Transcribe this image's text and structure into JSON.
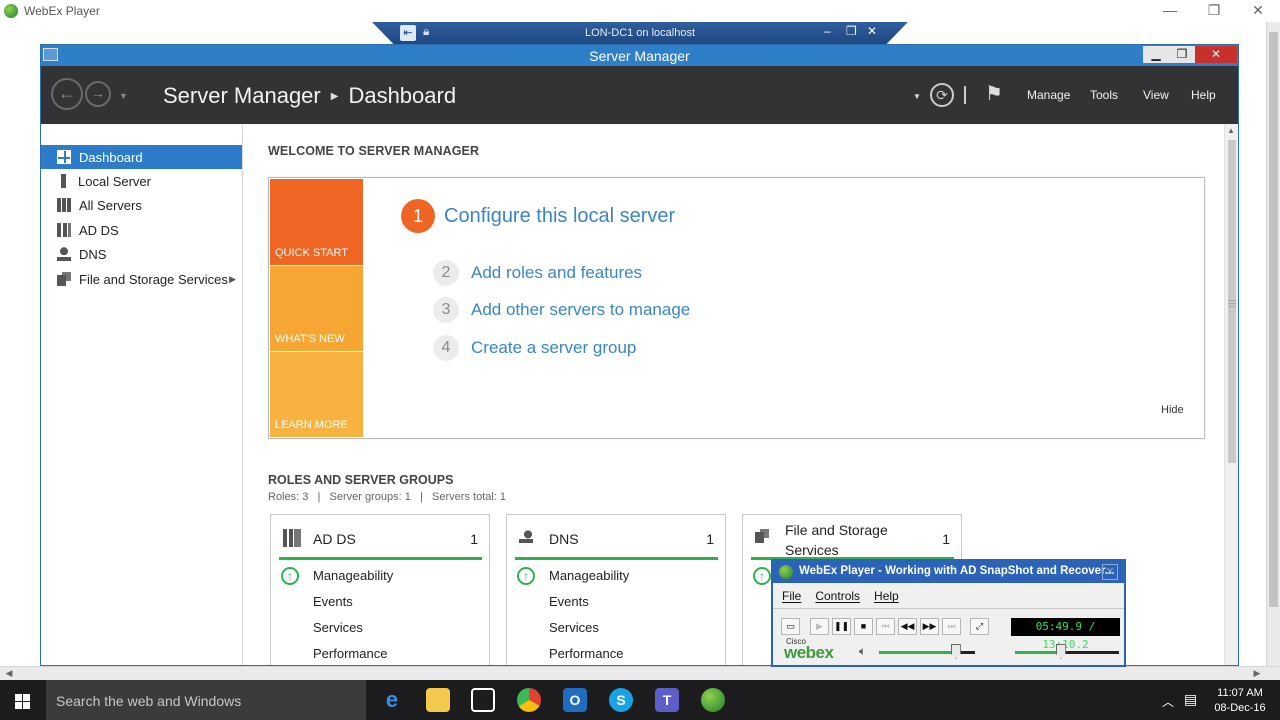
{
  "webex": {
    "title": "WebEx Player",
    "controls": {
      "minimize": "—",
      "restore": "❐",
      "close": "✕"
    }
  },
  "rdp": {
    "title": "LON-DC1 on localhost",
    "controls": {
      "minimize": "–",
      "restore": "❐",
      "close": "✕"
    }
  },
  "server_manager": {
    "window_title": "Server Manager",
    "breadcrumb": {
      "root": "Server Manager",
      "current": "Dashboard"
    },
    "header_menu": [
      "Manage",
      "Tools",
      "View",
      "Help"
    ],
    "nav_items": [
      {
        "label": "Dashboard",
        "icon": "dashboard-icon",
        "active": true
      },
      {
        "label": "Local Server",
        "icon": "server-icon"
      },
      {
        "label": "All Servers",
        "icon": "servers-icon"
      },
      {
        "label": "AD DS",
        "icon": "ad-ds-icon"
      },
      {
        "label": "DNS",
        "icon": "dns-icon"
      },
      {
        "label": "File and Storage Services",
        "icon": "file-storage-icon",
        "has_submenu": true
      }
    ],
    "welcome": {
      "heading": "WELCOME TO SERVER MANAGER",
      "tiles": [
        "QUICK START",
        "WHAT'S NEW",
        "LEARN MORE"
      ],
      "primary_step": {
        "num": "1",
        "label": "Configure this local server"
      },
      "steps": [
        {
          "num": "2",
          "label": "Add roles and features"
        },
        {
          "num": "3",
          "label": "Add other servers to manage"
        },
        {
          "num": "4",
          "label": "Create a server group"
        }
      ],
      "hide": "Hide"
    },
    "roles": {
      "heading": "ROLES AND SERVER GROUPS",
      "summary": "Roles: 3   |   Server groups: 1   |   Servers total: 1",
      "cards": [
        {
          "name": "AD DS",
          "count": "1",
          "rows": [
            "Manageability",
            "Events",
            "Services",
            "Performance"
          ]
        },
        {
          "name": "DNS",
          "count": "1",
          "rows": [
            "Manageability",
            "Events",
            "Services",
            "Performance"
          ]
        },
        {
          "name": "File and Storage Services",
          "count": "1",
          "rows": []
        }
      ]
    }
  },
  "player": {
    "title": "WebEx Player - Working with AD SnapShot and Recover...",
    "menu": [
      "File",
      "Controls",
      "Help"
    ],
    "time": "05:49.9 / 13:10.2",
    "brand_small": "Cisco",
    "brand": "webex",
    "progress_fraction": 0.44,
    "volume_fraction": 0.8
  },
  "taskbar": {
    "search_placeholder": "Search the web and Windows",
    "time": "11:07 AM",
    "date": "08-Dec-16"
  },
  "colors": {
    "accent_blue": "#2d7cc9",
    "quick_start": "#ef6523",
    "whats_new": "#f6a733",
    "ok_green": "#2fb24c",
    "link_blue": "#3a86c4"
  }
}
